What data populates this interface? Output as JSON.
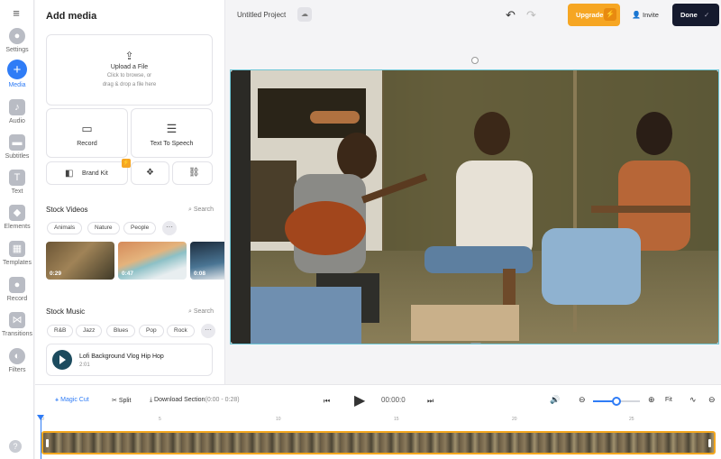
{
  "rail": {
    "items": [
      {
        "label": "Settings",
        "icon": "settings-icon"
      },
      {
        "label": "Media",
        "icon": "plus-icon"
      },
      {
        "label": "Audio",
        "icon": "audio-icon"
      },
      {
        "label": "Subtitles",
        "icon": "subtitles-icon"
      },
      {
        "label": "Text",
        "icon": "text-icon"
      },
      {
        "label": "Elements",
        "icon": "elements-icon"
      },
      {
        "label": "Templates",
        "icon": "templates-icon"
      },
      {
        "label": "Record",
        "icon": "record-icon"
      },
      {
        "label": "Transitions",
        "icon": "transitions-icon"
      },
      {
        "label": "Filters",
        "icon": "filters-icon"
      }
    ],
    "active": "Media",
    "help": "?"
  },
  "panel": {
    "title": "Add media",
    "upload": {
      "title": "Upload a File",
      "hint1": "Click to browse, or",
      "hint2": "drag & drop a file here"
    },
    "record_label": "Record",
    "tts_label": "Text To Speech",
    "brandkit_label": "Brand Kit",
    "stock_videos": {
      "title": "Stock Videos",
      "search": "Search",
      "chips": [
        "Animals",
        "Nature",
        "People"
      ],
      "durations": [
        "0:29",
        "0:47",
        "0:08"
      ]
    },
    "stock_music": {
      "title": "Stock Music",
      "search": "Search",
      "chips": [
        "R&B",
        "Jazz",
        "Blues",
        "Pop",
        "Rock"
      ],
      "track_title": "Lofi Background Vlog Hip Hop",
      "track_duration": "2:01"
    }
  },
  "topbar": {
    "project_name": "Untitled Project",
    "upgrade_label": "Upgrade",
    "invite_label": "Invite",
    "done_label": "Done"
  },
  "controls": {
    "magic_cut": "Magic Cut",
    "split": "Split",
    "download_section": "Download Section",
    "download_range": "(0:00 - 0:28)",
    "time": "00:00:0",
    "fit": "Fit",
    "zoom_fraction": 0.5
  },
  "timeline": {
    "ticks": [
      "0",
      "5",
      "10",
      "15",
      "20",
      "25"
    ]
  },
  "colors": {
    "accent": "#2f7cf6",
    "upgrade": "#f6a623",
    "done": "#151a2e",
    "track_border": "#f3a71f"
  }
}
